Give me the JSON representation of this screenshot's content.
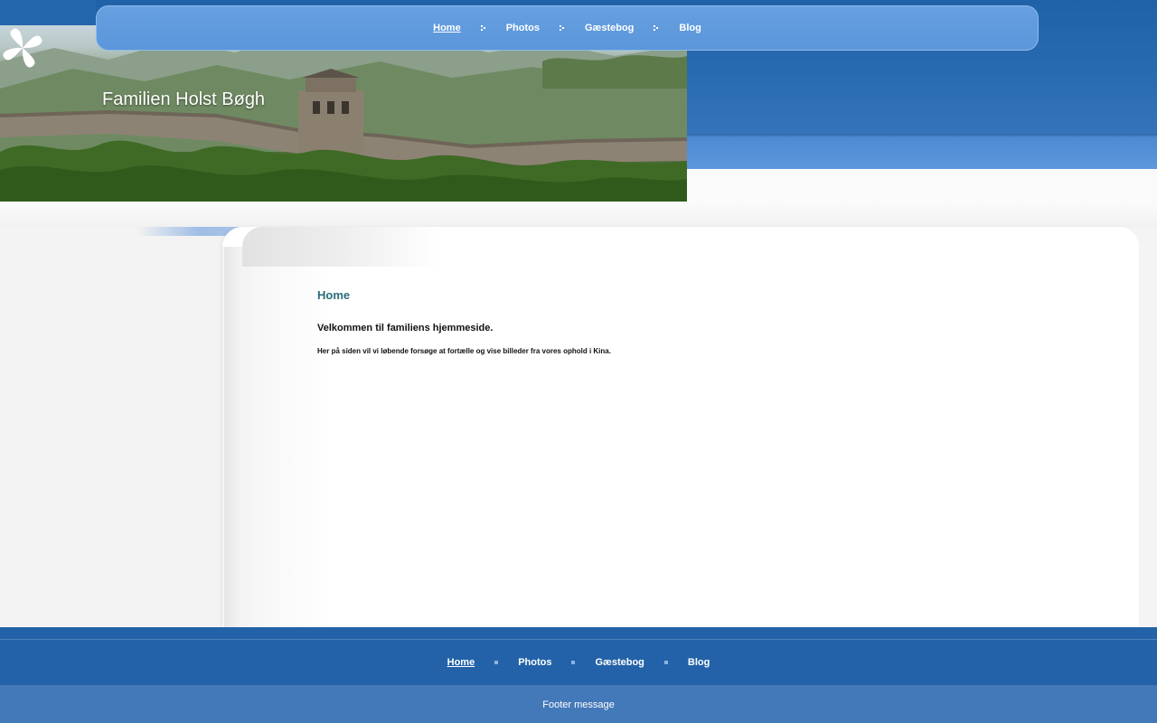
{
  "site": {
    "title": "Familien Holst Bøgh"
  },
  "nav": {
    "items": [
      {
        "label": "Home",
        "active": true
      },
      {
        "label": "Photos",
        "active": false
      },
      {
        "label": "Gæstebog",
        "active": false
      },
      {
        "label": "Blog",
        "active": false
      }
    ]
  },
  "main": {
    "heading": "Home",
    "welcome": "Velkommen til familiens hjemmeside.",
    "intro": "Her på siden vil vi løbende forsøge at fortælle og vise billeder fra vores ophold i Kina."
  },
  "footer": {
    "nav": [
      {
        "label": "Home",
        "active": true
      },
      {
        "label": "Photos",
        "active": false
      },
      {
        "label": "Gæstebog",
        "active": false
      },
      {
        "label": "Blog",
        "active": false
      }
    ],
    "message": "Footer message"
  },
  "icons": {
    "logo": "propeller-logo-icon",
    "nav_separator": "arrow-separator-icon",
    "footer_separator": "square-bullet-icon"
  },
  "colors": {
    "header_blue": "#2466ab",
    "nav_blue": "#5b96da",
    "heading_teal": "#2a6d78",
    "footer_blue": "#2362a8",
    "footer_message_blue": "#4479b9"
  }
}
